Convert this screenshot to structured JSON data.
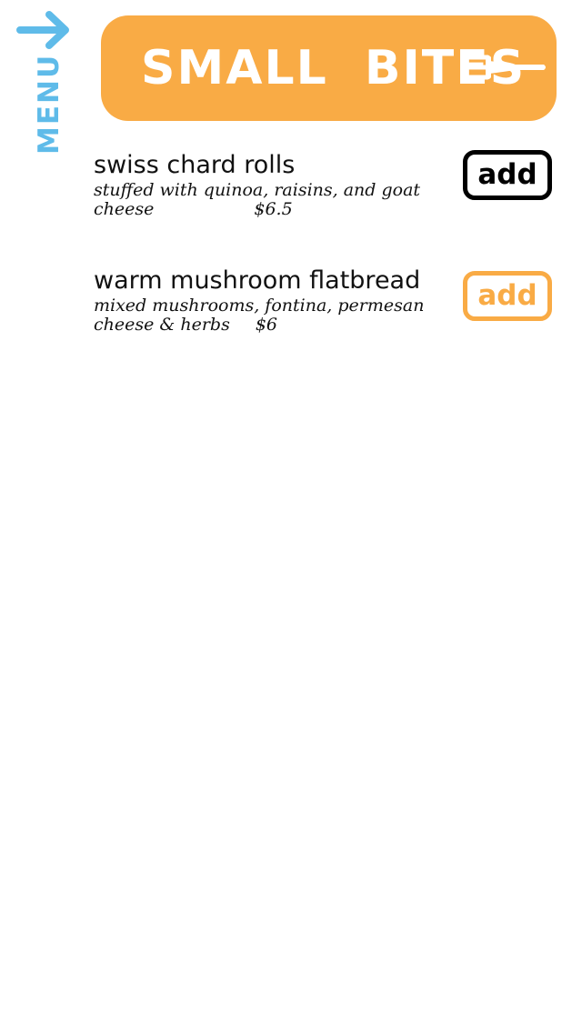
{
  "sidebar": {
    "menu_label": "MENU",
    "arrow_icon": "arrow-right-icon",
    "color": "#5fbbe9"
  },
  "header": {
    "title": "SMALL BITES",
    "icon": "fork-icon",
    "background_color": "#f9ab45",
    "text_color": "#ffffff"
  },
  "items": [
    {
      "name": "swiss chard rolls",
      "description_line1": "stuffed with quinoa, raisins, and goat",
      "description_line2": "cheese",
      "price": "$6.5",
      "button_label": "add",
      "button_color": "#000000"
    },
    {
      "name": "warm mushroom flatbread",
      "description_line1": "mixed mushrooms, fontina, permesan",
      "description_line2": "cheese & herbs",
      "price": "$6",
      "button_label": "add",
      "button_color": "#f9ab45"
    }
  ]
}
